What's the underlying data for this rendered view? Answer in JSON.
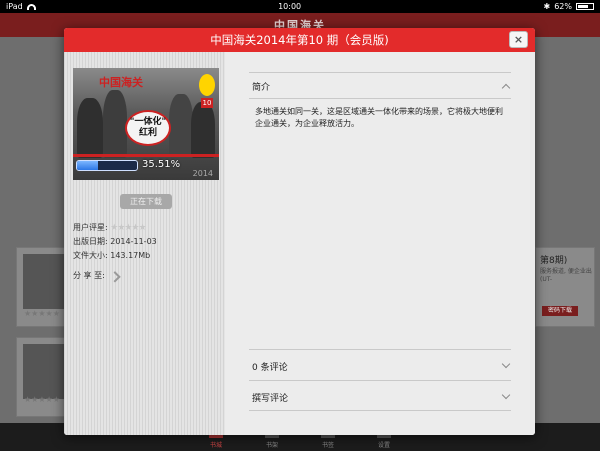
{
  "status_bar": {
    "device": "iPad",
    "time": "10:00",
    "battery": "62%"
  },
  "app": {
    "logo": "中国海关"
  },
  "background": {
    "right_card_title": "第8期)",
    "right_card_text": "服务报道, 便企业出 (UT-",
    "password_download": "密码下载"
  },
  "tabbar": {
    "tabs": [
      {
        "label": "书城",
        "active": true
      },
      {
        "label": "书架",
        "active": false
      },
      {
        "label": "书签",
        "active": false
      },
      {
        "label": "设置",
        "active": false
      }
    ]
  },
  "modal": {
    "title": "中国海关2014年第10 期（会员版)",
    "close_icon": "×",
    "cover": {
      "masthead": "中国海关",
      "headline_line1": "\"一体化\"",
      "headline_line2": "红利",
      "issue": "10",
      "year": "2014",
      "progress_percent": 35.51,
      "progress_label": "35.51%"
    },
    "download_button": "正在下载",
    "rating_label": "用户评星:",
    "rating_stars": "★★★★★",
    "publish_date_label": "出版日期:",
    "publish_date": "2014-11-03",
    "file_size_label": "文件大小:",
    "file_size": "143.17Mb",
    "share_label": "分 享 至:",
    "intro_title": "简介",
    "intro_text": "多地通关如同一关，这是区域通关一体化带来的场景，它将极大地便利企业通关，为企业释放活力。",
    "comments_title": "0 条评论",
    "write_comment_title": "撰写评论"
  },
  "colors": {
    "header_red": "#e32b2b",
    "progress_blue": "#2d77e6"
  }
}
